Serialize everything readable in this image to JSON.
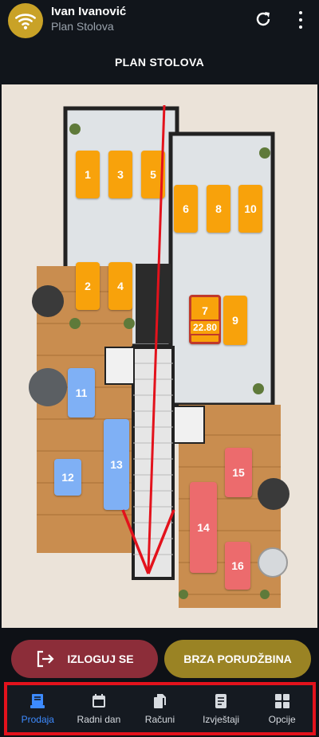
{
  "header": {
    "user_name": "Ivan Ivanović",
    "subtitle": "Plan Stolova",
    "title": "PLAN STOLOVA",
    "avatar_icon": "wifi-icon",
    "avatar_color": "#c9a227"
  },
  "tables": [
    {
      "id": "1",
      "label": "1",
      "color": "orange"
    },
    {
      "id": "3",
      "label": "3",
      "color": "orange"
    },
    {
      "id": "5",
      "label": "5",
      "color": "orange"
    },
    {
      "id": "6",
      "label": "6",
      "color": "orange"
    },
    {
      "id": "8",
      "label": "8",
      "color": "orange"
    },
    {
      "id": "10",
      "label": "10",
      "color": "orange"
    },
    {
      "id": "2",
      "label": "2",
      "color": "orange"
    },
    {
      "id": "4",
      "label": "4",
      "color": "orange"
    },
    {
      "id": "7",
      "label": "7",
      "color": "orange",
      "amount": "22.80",
      "selected": true
    },
    {
      "id": "9",
      "label": "9",
      "color": "orange"
    },
    {
      "id": "11",
      "label": "11",
      "color": "blue"
    },
    {
      "id": "13",
      "label": "13",
      "color": "blue"
    },
    {
      "id": "12",
      "label": "12",
      "color": "blue"
    },
    {
      "id": "15",
      "label": "15",
      "color": "red"
    },
    {
      "id": "14",
      "label": "14",
      "color": "red"
    },
    {
      "id": "16",
      "label": "16",
      "color": "red"
    }
  ],
  "colors": {
    "orange": "#f8a20b",
    "blue": "#7fb0f5",
    "red": "#ec6b6d",
    "logout": "#8c2d39",
    "quick_order": "#9a8324",
    "nav_active": "#3d8bff",
    "highlight": "#e3121c"
  },
  "actions": {
    "logout_label": "IZLOGUJ SE",
    "quick_order_label": "BRZA PORUDŽBINA"
  },
  "nav": {
    "items": [
      {
        "label": "Prodaja",
        "icon": "receipt-icon",
        "active": true
      },
      {
        "label": "Radni dan",
        "icon": "calendar-icon"
      },
      {
        "label": "Računi",
        "icon": "documents-icon"
      },
      {
        "label": "Izvještaji",
        "icon": "report-icon"
      },
      {
        "label": "Opcije",
        "icon": "grid-icon"
      }
    ]
  }
}
